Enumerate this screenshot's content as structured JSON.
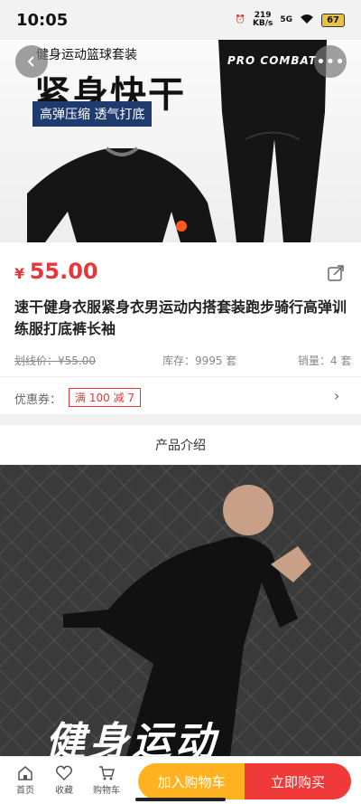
{
  "status": {
    "time": "10:05",
    "net_speed": "219",
    "net_unit": "KB/s",
    "signal": "5G",
    "battery": "67"
  },
  "hero": {
    "caption": "健身运动篮球套装",
    "title": "紧身快干",
    "tag": "高弹压缩 透气打底",
    "brand": "PRO COMBAT"
  },
  "nav": {
    "back_icon": "chevron-left-icon",
    "more_icon": "more-icon"
  },
  "product": {
    "currency": "¥",
    "price": "55.00",
    "title": "速干健身衣服紧身衣男运动内搭套装跑步骑行高弹训练服打底裤长袖",
    "original_price": "划线价：¥55.00",
    "stock": "库存：9995 套",
    "sales": "销量：4 套",
    "coupon_label": "优惠券：",
    "coupon": "满 100 减 7"
  },
  "section": {
    "title": "产品介绍"
  },
  "promo": {
    "overlay_text": "健身运动"
  },
  "bottom": {
    "home": "首页",
    "favorite": "收藏",
    "cart": "购物车",
    "add_to_cart": "加入购物车",
    "buy_now": "立即购买"
  },
  "colors": {
    "price_red": "#e4393c",
    "cart_orange": "#ffb21f",
    "buy_red": "#f03a3a"
  }
}
